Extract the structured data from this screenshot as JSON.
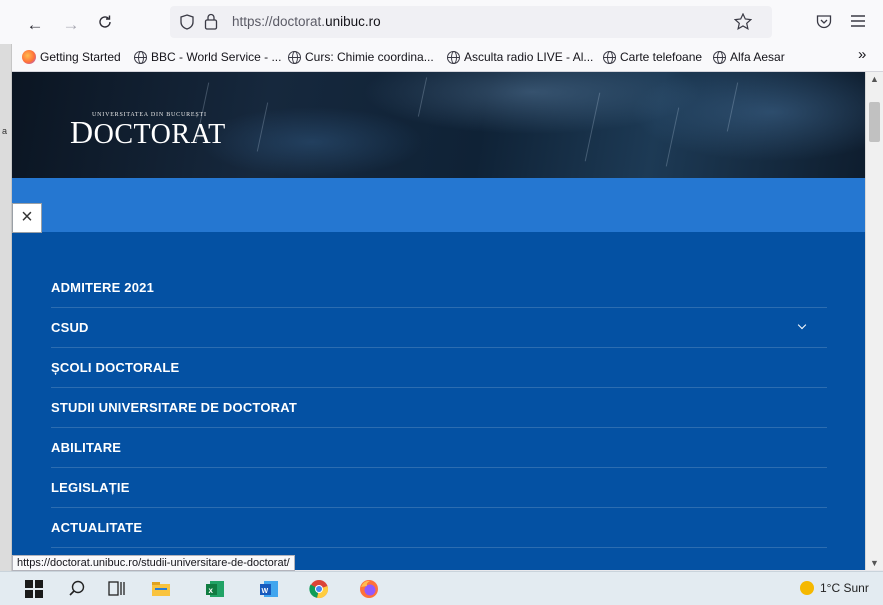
{
  "browser": {
    "url_prefix": "https://doctorat.",
    "url_domain": "unibuc.ro",
    "bookmarks": [
      {
        "label": "Getting Started",
        "icon": "firefox-icon"
      },
      {
        "label": "BBC - World Service - ...",
        "icon": "globe-icon"
      },
      {
        "label": "Curs: Chimie coordina...",
        "icon": "globe-icon"
      },
      {
        "label": "Asculta radio LIVE - Al...",
        "icon": "globe-icon"
      },
      {
        "label": "Carte telefoane",
        "icon": "globe-icon"
      },
      {
        "label": "Alfa Aesar",
        "icon": "globe-icon"
      }
    ],
    "overflow_label": "»",
    "status_url": "https://doctorat.unibuc.ro/studii-universitare-de-doctorat/"
  },
  "site": {
    "logo_small": "UNIVERSITATEA DIN BUCUREȘTI",
    "logo_first": "D",
    "logo_rest": "OCTORAT",
    "close_symbol": "×",
    "menu": [
      {
        "label": "ADMITERE 2021",
        "has_submenu": false
      },
      {
        "label": "CSUD",
        "has_submenu": true
      },
      {
        "label": "ȘCOLI DOCTORALE",
        "has_submenu": false
      },
      {
        "label": "STUDII UNIVERSITARE DE DOCTORAT",
        "has_submenu": false
      },
      {
        "label": "ABILITARE",
        "has_submenu": false
      },
      {
        "label": "LEGISLAȚIE",
        "has_submenu": false
      },
      {
        "label": "ACTUALITATE",
        "has_submenu": false
      }
    ]
  },
  "taskbar": {
    "weather_text": "1°C Sunr"
  },
  "colors": {
    "menu_bg": "#0451a3",
    "band_bg": "#2577d1"
  }
}
